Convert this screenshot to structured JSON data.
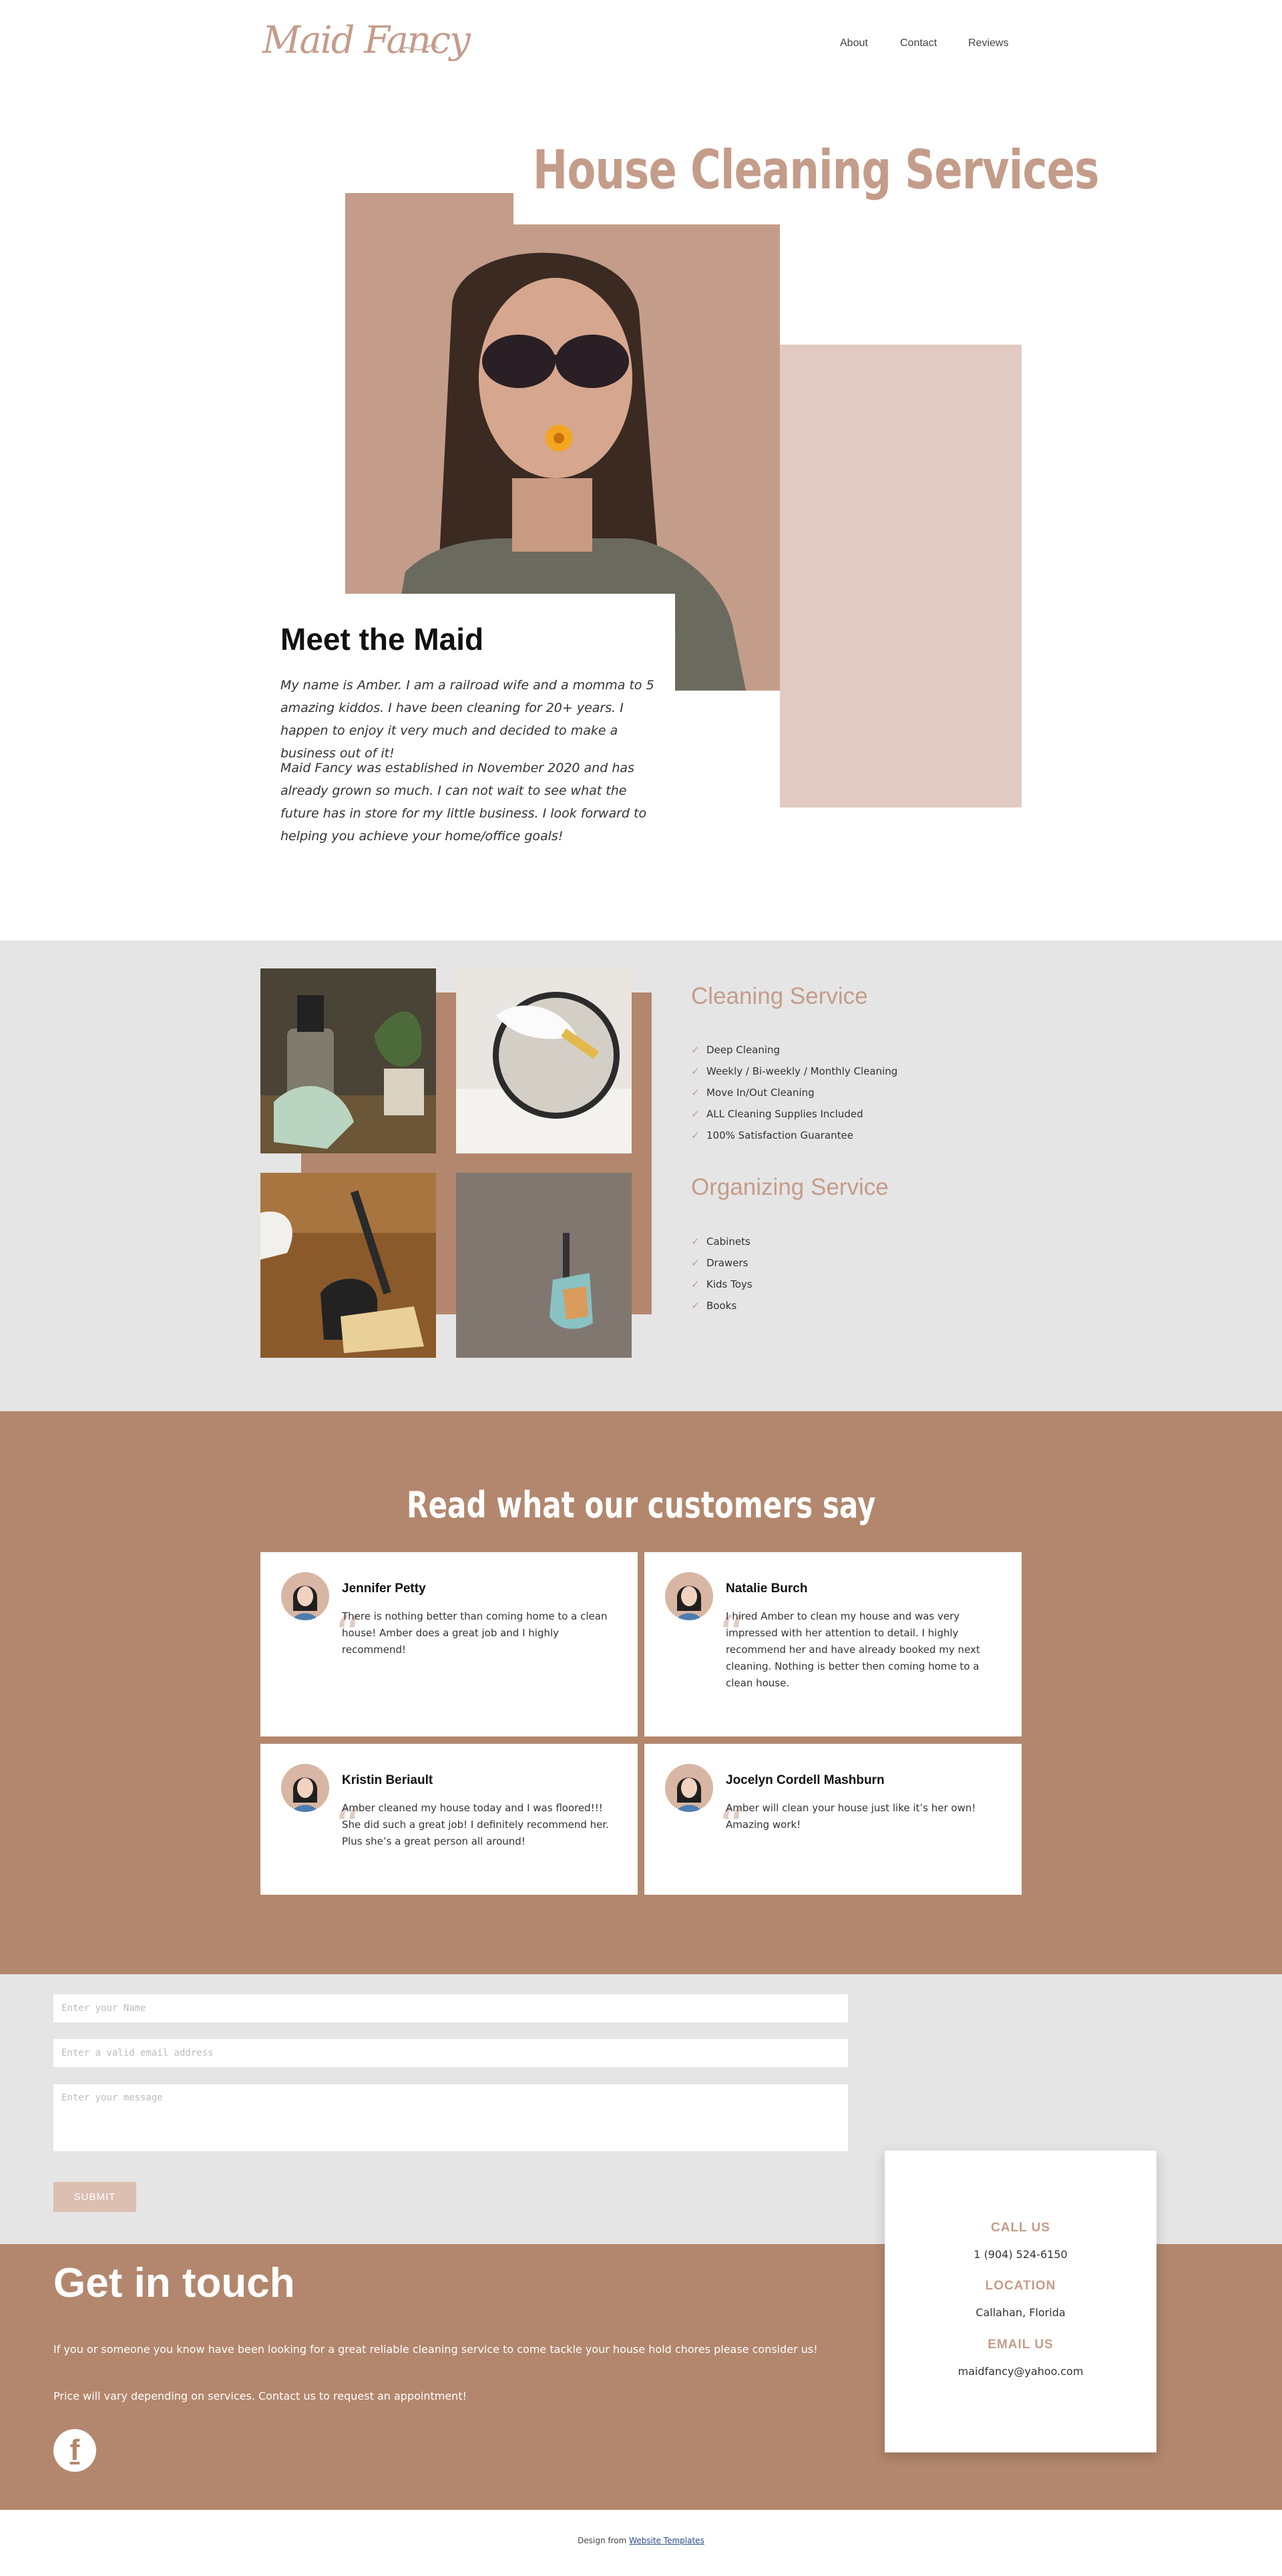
{
  "header": {
    "logo_text": "Maid Fancy",
    "nav": [
      {
        "label": "About"
      },
      {
        "label": "Contact"
      },
      {
        "label": "Reviews"
      }
    ]
  },
  "hero": {
    "title": "House Cleaning Services",
    "meet_title": "Meet the Maid",
    "paragraphs": [
      "My name is Amber. I am a railroad wife and a momma to 5 amazing kiddos. I have been cleaning for 20+ years. I happen to enjoy it very much and decided to make a business out of it!",
      "Maid Fancy was established in November 2020 and has already grown so much. I can not wait to see what the future has in store for my little business. I look forward to helping you achieve your home/office goals!"
    ]
  },
  "services": {
    "cleaning_title": "Cleaning Service",
    "cleaning_items": [
      "Deep Cleaning",
      "Weekly / Bi-weekly / Monthly Cleaning",
      "Move In/Out Cleaning",
      "ALL Cleaning Supplies Included",
      "100% Satisfaction Guarantee"
    ],
    "organizing_title": "Organizing Service",
    "organizing_items": [
      "Cabinets",
      "Drawers",
      "Kids Toys",
      "Books"
    ],
    "check_icon": "check-icon"
  },
  "reviews": {
    "title": "Read what our customers say",
    "items": [
      {
        "name": "Jennifer Petty",
        "text": "There is nothing better than coming home to a clean house! Amber does a great job and I highly recommend!"
      },
      {
        "name": "Natalie Burch",
        "text": "I hired Amber to clean my house and was very impressed with her attention to detail. I highly recommend her and have already booked my next cleaning. Nothing is better then coming home to a clean house."
      },
      {
        "name": "Kristin Beriault",
        "text": "Amber cleaned my house today and I was floored!!! She did such a great job! I definitely recommend her. Plus she’s a great person all around!"
      },
      {
        "name": "Jocelyn Cordell Mashburn",
        "text": "Amber will clean your house just like it’s her own! Amazing work!"
      }
    ]
  },
  "form": {
    "name_placeholder": "Enter your Name",
    "email_placeholder": "Enter a valid email address",
    "message_placeholder": "Enter your message",
    "submit_label": "SUBMIT"
  },
  "touch": {
    "title": "Get in touch",
    "p1": "If you or someone you know have been looking for a great reliable cleaning service to come tackle your house hold chores please consider us!",
    "p2": "Price will vary depending on services. Contact us to request an appointment!",
    "social_icon": "facebook-icon"
  },
  "info": {
    "call_label": "CALL US",
    "call_value": "1 (904) 524-6150",
    "location_label": "LOCATION",
    "location_value": "Callahan, Florida",
    "email_label": "EMAIL US",
    "email_value": "maidfancy@yahoo.com"
  },
  "footer": {
    "prefix": "Design from",
    "link_text": "Website Templates"
  },
  "colors": {
    "accent": "#c49c8a",
    "brown": "#b3876d",
    "light_pink": "#e1cac1",
    "gray_bg": "#e5e5e5"
  }
}
